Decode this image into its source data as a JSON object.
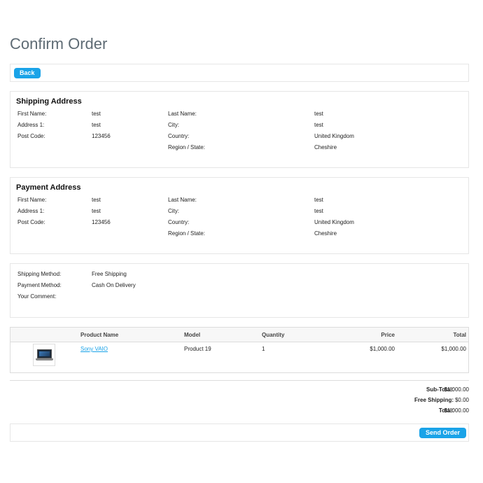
{
  "page": {
    "title": "Confirm Order"
  },
  "toolbar": {
    "back_label": "Back"
  },
  "shipping_address": {
    "title": "Shipping Address",
    "first_name_label": "First Name:",
    "first_name": "test",
    "last_name_label": "Last Name:",
    "last_name": "test",
    "address1_label": "Address 1:",
    "address1": "test",
    "city_label": "City:",
    "city": "test",
    "postcode_label": "Post Code:",
    "postcode": "123456",
    "country_label": "Country:",
    "country": "United Kingdom",
    "region_label": "Region / State:",
    "region": "Cheshire"
  },
  "payment_address": {
    "title": "Payment Address",
    "first_name_label": "First Name:",
    "first_name": "test",
    "last_name_label": "Last Name:",
    "last_name": "test",
    "address1_label": "Address 1:",
    "address1": "test",
    "city_label": "City:",
    "city": "test",
    "postcode_label": "Post Code:",
    "postcode": "123456",
    "country_label": "Country:",
    "country": "United Kingdom",
    "region_label": "Region / State:",
    "region": "Cheshire"
  },
  "methods": {
    "shipping_label": "Shipping Method:",
    "shipping": "Free Shipping",
    "payment_label": "Payment Method:",
    "payment": "Cash On Delivery",
    "comment_label": "Your Comment:"
  },
  "products": {
    "headers": {
      "name": "Product Name",
      "model": "Model",
      "quantity": "Quantity",
      "price": "Price",
      "total": "Total"
    },
    "rows": [
      {
        "image_icon": "laptop-icon",
        "name": "Sony VAIO",
        "model": "Product 19",
        "quantity": "1",
        "price": "$1,000.00",
        "total": "$1,000.00"
      }
    ]
  },
  "totals": {
    "subtotal_label": "Sub-Total:",
    "subtotal": "$1,000.00",
    "shipping_label": "Free Shipping:",
    "shipping": "$0.00",
    "total_label": "Total:",
    "total": "$1,000.00"
  },
  "actions": {
    "send_label": "Send Order"
  },
  "colors": {
    "accent": "#1aa3e8",
    "title": "#5e6b74",
    "border": "#e6e6e6"
  }
}
